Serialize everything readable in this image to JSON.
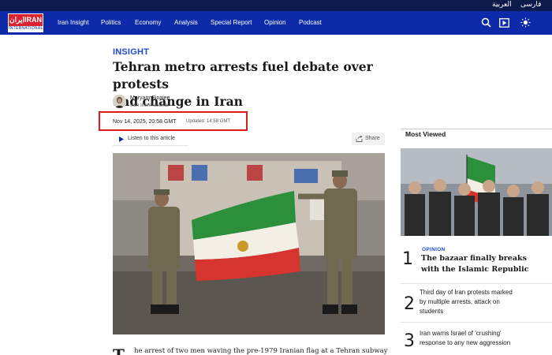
{
  "lang_strip": {
    "farsi": "فارسی",
    "arabic": "العربية"
  },
  "logo": {
    "top_text": "ایرانIRAN",
    "bottom_text": "INTERNATIONAL"
  },
  "nav": {
    "items": [
      "Iran Insight",
      "Politics",
      "Economy",
      "Analysis",
      "Special Report",
      "Opinion",
      "Podcast"
    ],
    "icons": [
      "search-icon",
      "video-icon",
      "brightness-icon"
    ]
  },
  "article": {
    "kicker": "INSIGHT",
    "headline_line1": "Tehran metro arrests fuel debate over protests",
    "headline_line2": "and change in Iran",
    "author": "Maryam Sinaiee",
    "author_org": "Iran International",
    "date": "Nov 14, 2025, 20:58 GMT",
    "updated": "Updated: 14:58 GMT",
    "listen_label": "Listen to this article",
    "share_label": "Share",
    "dropcap": "T",
    "body_line1": "he arrest of two men waving the pre-1979 Iranian flag at a Tehran subway"
  },
  "sidebar": {
    "title": "Most Viewed",
    "items": [
      {
        "number": "1",
        "kicker": "OPINION",
        "line1": "The bazaar finally breaks",
        "line2": "with the Islamic Republic"
      },
      {
        "number": "2",
        "line1": "Third day of Iran protests marked",
        "line2": "by multiple arrests, attack on",
        "line3": "students"
      },
      {
        "number": "3",
        "line1": "Iran warns Israel of 'crushing'",
        "line2": "response to any new aggression"
      }
    ]
  },
  "colors": {
    "nav_bg": "#0d2aa8",
    "top_strip": "#0b1a4a",
    "accent_blue": "#1e48d6",
    "highlight_red": "#e0191e",
    "logo_red": "#d9232e"
  }
}
